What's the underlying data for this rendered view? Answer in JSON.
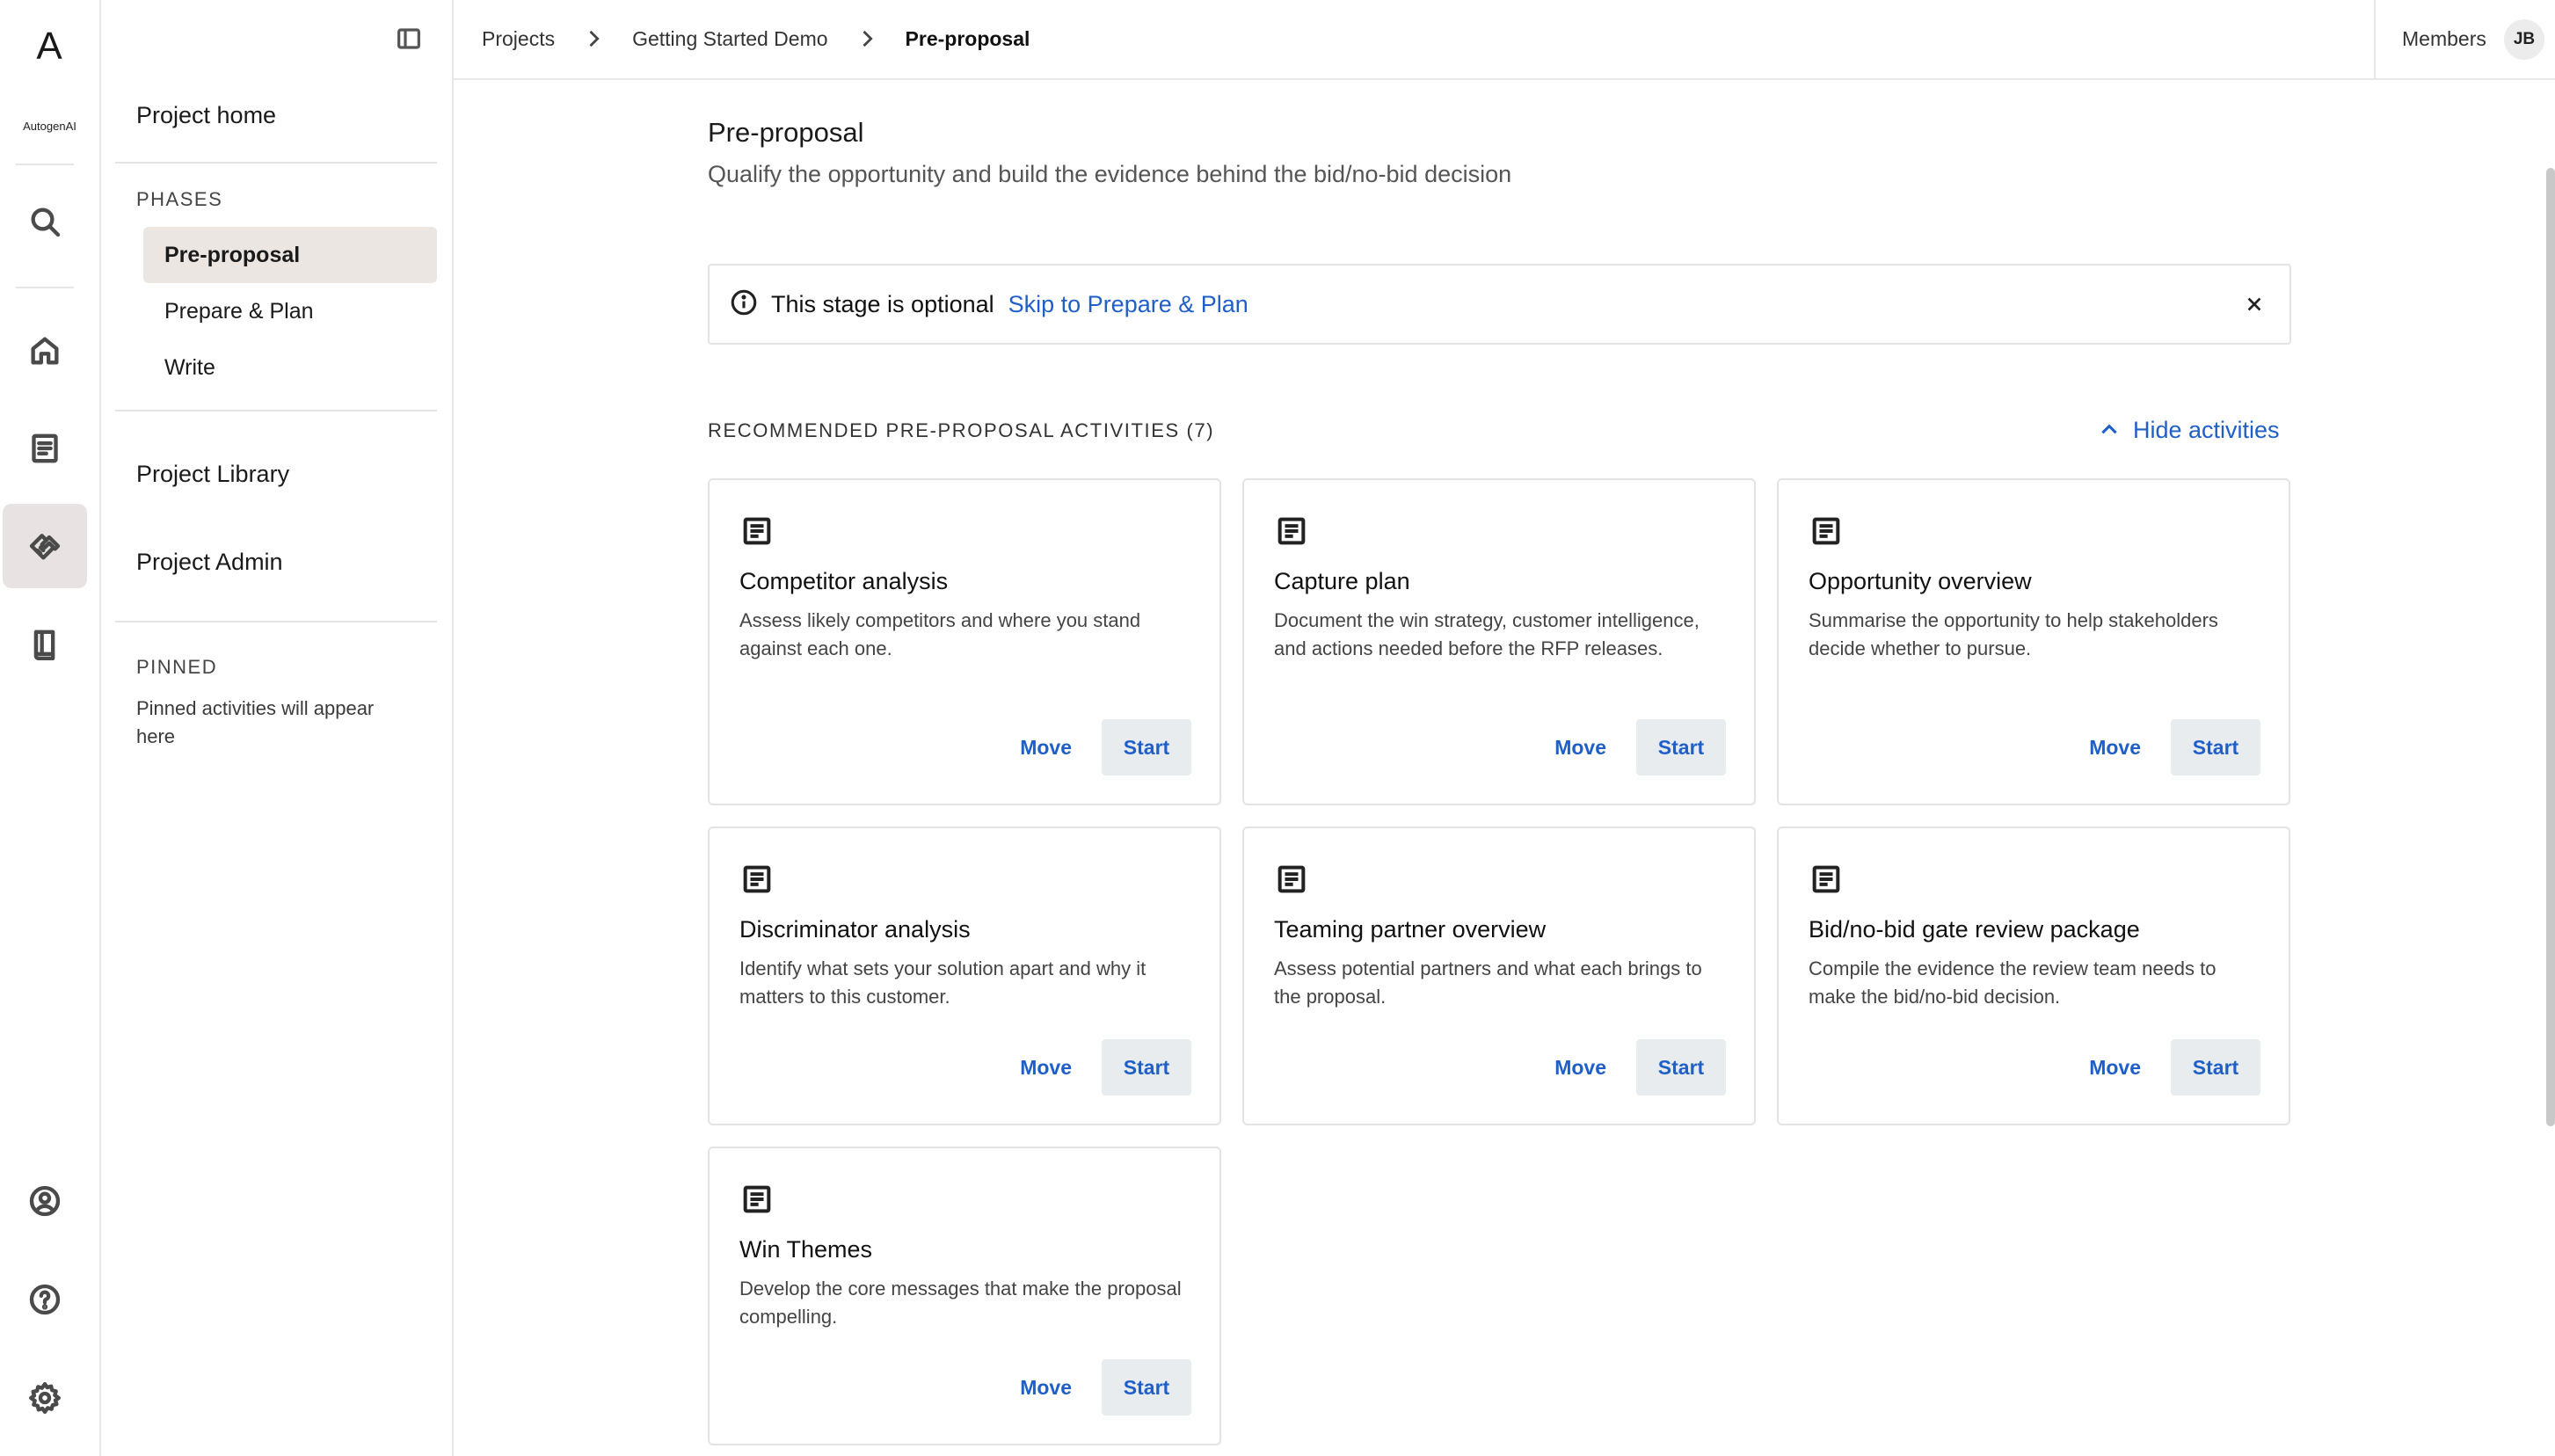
{
  "brand": {
    "logo_letter": "A",
    "logo_text": "AutogenAI"
  },
  "rail": {
    "items": [
      {
        "name": "search-icon",
        "interactable": true
      },
      {
        "name": "home-icon",
        "interactable": true
      },
      {
        "name": "document-icon",
        "interactable": true
      },
      {
        "name": "handshake-icon",
        "interactable": true,
        "active": true
      },
      {
        "name": "library-icon",
        "interactable": true
      },
      {
        "name": "user-circle-icon",
        "interactable": true
      },
      {
        "name": "help-icon",
        "interactable": true
      },
      {
        "name": "gear-icon",
        "interactable": true
      }
    ]
  },
  "sidebar": {
    "project_home": "Project home",
    "phases_heading": "PHASES",
    "phases": [
      "Pre-proposal",
      "Prepare & Plan",
      "Write"
    ],
    "active_phase": "Pre-proposal",
    "project_library": "Project Library",
    "project_admin": "Project Admin",
    "pinned_heading": "PINNED",
    "pinned_note": "Pinned activities will appear here"
  },
  "breadcrumb": {
    "items": [
      "Projects",
      "Getting Started Demo",
      "Pre-proposal"
    ]
  },
  "header": {
    "members_label": "Members",
    "avatar_initials": "JB"
  },
  "page": {
    "title": "Pre-proposal",
    "subtitle": "Qualify the opportunity and build the evidence behind the bid/no-bid decision"
  },
  "banner": {
    "text": "This stage is optional",
    "link": "Skip to Prepare & Plan"
  },
  "activities": {
    "heading": "RECOMMENDED PRE-PROPOSAL ACTIVITIES (7)",
    "toggle_label": "Hide activities",
    "move_label": "Move",
    "start_label": "Start",
    "cards": [
      {
        "title": "Competitor analysis",
        "description": "Assess likely competitors and where you stand against each one."
      },
      {
        "title": "Capture plan",
        "description": "Document the win strategy, customer intelligence, and actions needed before the RFP releases."
      },
      {
        "title": "Opportunity overview",
        "description": "Summarise the opportunity to help stakeholders decide whether to pursue."
      },
      {
        "title": "Discriminator analysis",
        "description": "Identify what sets your solution apart and why it matters to this customer."
      },
      {
        "title": "Teaming partner overview",
        "description": "Assess potential partners and what each brings to the proposal."
      },
      {
        "title": "Bid/no-bid gate review package",
        "description": "Compile the evidence the review team needs to make the bid/no-bid decision."
      },
      {
        "title": "Win Themes",
        "description": "Develop the core messages that make the proposal compelling."
      }
    ]
  },
  "colors": {
    "accent": "#1f5fc7",
    "active_bg": "#ece6e3",
    "border": "#e3e3e3"
  }
}
